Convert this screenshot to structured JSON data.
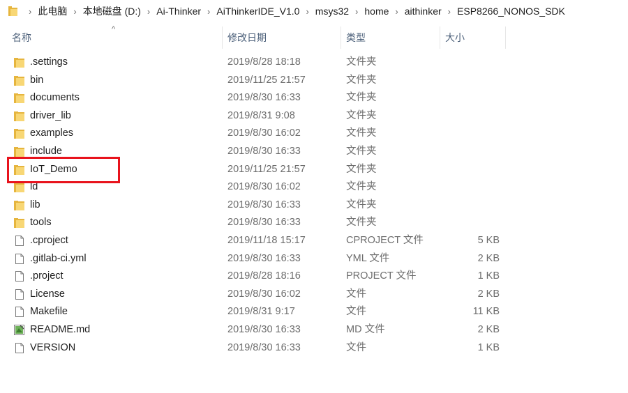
{
  "address_bar": {
    "crumbs": [
      "此电脑",
      "本地磁盘 (D:)",
      "Ai-Thinker",
      "AiThinkerIDE_V1.0",
      "msys32",
      "home",
      "aithinker",
      "ESP8266_NONOS_SDK"
    ],
    "separator": "›"
  },
  "columns": {
    "name": "名称",
    "date": "修改日期",
    "type": "类型",
    "size": "大小"
  },
  "files": [
    {
      "name": ".settings",
      "date": "2019/8/28 18:18",
      "type": "文件夹",
      "size": "",
      "icon": "folder-icon"
    },
    {
      "name": "bin",
      "date": "2019/11/25 21:57",
      "type": "文件夹",
      "size": "",
      "icon": "folder-icon"
    },
    {
      "name": "documents",
      "date": "2019/8/30 16:33",
      "type": "文件夹",
      "size": "",
      "icon": "folder-icon"
    },
    {
      "name": "driver_lib",
      "date": "2019/8/31 9:08",
      "type": "文件夹",
      "size": "",
      "icon": "folder-icon"
    },
    {
      "name": "examples",
      "date": "2019/8/30 16:02",
      "type": "文件夹",
      "size": "",
      "icon": "folder-icon"
    },
    {
      "name": "include",
      "date": "2019/8/30 16:33",
      "type": "文件夹",
      "size": "",
      "icon": "folder-icon"
    },
    {
      "name": "IoT_Demo",
      "date": "2019/11/25 21:57",
      "type": "文件夹",
      "size": "",
      "icon": "folder-icon"
    },
    {
      "name": "ld",
      "date": "2019/8/30 16:02",
      "type": "文件夹",
      "size": "",
      "icon": "folder-icon"
    },
    {
      "name": "lib",
      "date": "2019/8/30 16:33",
      "type": "文件夹",
      "size": "",
      "icon": "folder-icon"
    },
    {
      "name": "tools",
      "date": "2019/8/30 16:33",
      "type": "文件夹",
      "size": "",
      "icon": "folder-icon"
    },
    {
      "name": ".cproject",
      "date": "2019/11/18 15:17",
      "type": "CPROJECT 文件",
      "size": "5 KB",
      "icon": "file-icon"
    },
    {
      "name": ".gitlab-ci.yml",
      "date": "2019/8/30 16:33",
      "type": "YML 文件",
      "size": "2 KB",
      "icon": "file-icon"
    },
    {
      "name": ".project",
      "date": "2019/8/28 18:16",
      "type": "PROJECT 文件",
      "size": "1 KB",
      "icon": "file-icon"
    },
    {
      "name": "License",
      "date": "2019/8/30 16:02",
      "type": "文件",
      "size": "2 KB",
      "icon": "file-icon"
    },
    {
      "name": "Makefile",
      "date": "2019/8/31 9:17",
      "type": "文件",
      "size": "11 KB",
      "icon": "file-icon"
    },
    {
      "name": "README.md",
      "date": "2019/8/30 16:33",
      "type": "MD 文件",
      "size": "2 KB",
      "icon": "markdown-file-icon"
    },
    {
      "name": "VERSION",
      "date": "2019/8/30 16:33",
      "type": "文件",
      "size": "1 KB",
      "icon": "file-icon"
    }
  ],
  "highlight_item": "IoT_Demo",
  "colors": {
    "folder": "#f8d775",
    "folder_dark": "#e6b53e",
    "highlight_box": "#e8131c",
    "header_text": "#4c607a",
    "meta_text": "#6d6d6d"
  }
}
